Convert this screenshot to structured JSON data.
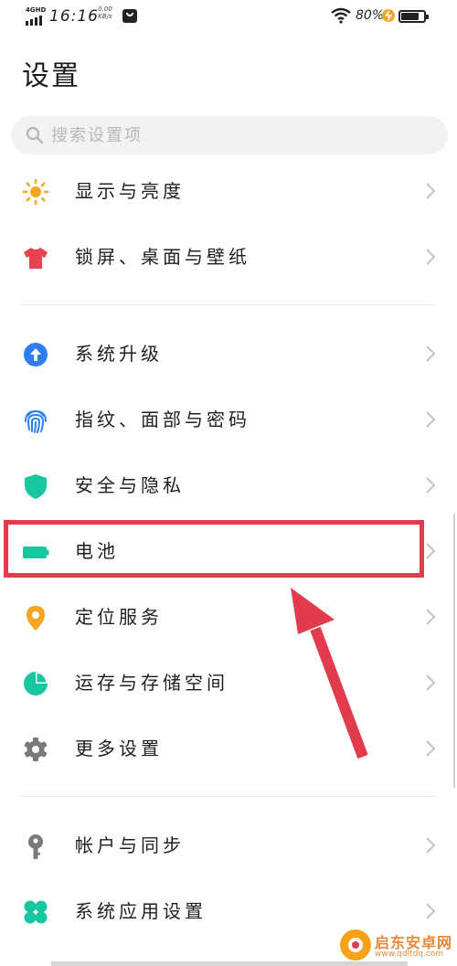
{
  "status_bar": {
    "network": "4GHD",
    "time": "16:16",
    "speed_value": "0.00",
    "speed_unit": "KB/s",
    "battery_percent": "80%",
    "battery_level": 0.8,
    "icons": [
      "signal-icon",
      "notification-icon",
      "wifi-icon",
      "charging-icon",
      "battery-icon"
    ]
  },
  "page": {
    "title": "设置"
  },
  "search": {
    "placeholder": "搜索设置项",
    "icon": "search-icon"
  },
  "settings": [
    {
      "label": "显示与亮度",
      "icon": "sun-icon",
      "color": "#f5a623"
    },
    {
      "label": "锁屏、桌面与壁纸",
      "icon": "tshirt-icon",
      "color": "#e8414f"
    },
    {
      "label": "系统升级",
      "icon": "upgrade-arrow-icon",
      "color": "#2e7ef2"
    },
    {
      "label": "指纹、面部与密码",
      "icon": "fingerprint-icon",
      "color": "#2e7ef2"
    },
    {
      "label": "安全与隐私",
      "icon": "shield-icon",
      "color": "#18c7a0"
    },
    {
      "label": "电池",
      "icon": "battery-icon",
      "color": "#18c7a0"
    },
    {
      "label": "定位服务",
      "icon": "location-pin-icon",
      "color": "#f5a623"
    },
    {
      "label": "运存与存储空间",
      "icon": "pie-chart-icon",
      "color": "#18c7a0"
    },
    {
      "label": "更多设置",
      "icon": "gear-icon",
      "color": "#7a7a7a"
    },
    {
      "label": "帐户与同步",
      "icon": "key-icon",
      "color": "#7a7a7a"
    },
    {
      "label": "系统应用设置",
      "icon": "clover-icon",
      "color": "#18c7a0"
    }
  ],
  "watermark": {
    "name": "启东安卓网",
    "url": "www.qdltdq.com"
  },
  "annotation": {
    "highlight_color": "#e23b4d"
  }
}
